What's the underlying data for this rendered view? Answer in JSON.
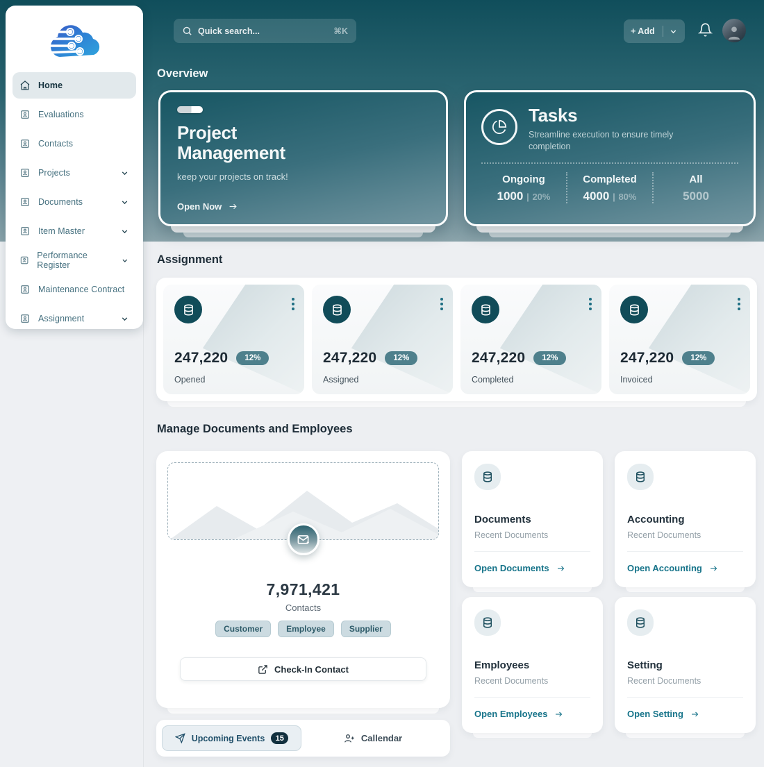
{
  "header": {
    "search_placeholder": "Quick search...",
    "search_shortcut": "⌘K",
    "add_button": "+ Add"
  },
  "sidebar": {
    "items": [
      {
        "label": "Home"
      },
      {
        "label": "Evaluations"
      },
      {
        "label": "Contacts"
      },
      {
        "label": "Projects"
      },
      {
        "label": "Documents"
      },
      {
        "label": "Item Master"
      },
      {
        "label": "Performance Register"
      },
      {
        "label": "Maintenance Contract"
      },
      {
        "label": "Assignment"
      }
    ]
  },
  "overview": {
    "title": "Overview",
    "project_card": {
      "title": "Project Management",
      "subtitle": "keep your projects on track!",
      "cta": "Open Now"
    },
    "tasks_card": {
      "title": "Tasks",
      "subtitle": "Streamline execution to ensure timely completion",
      "stats": [
        {
          "label": "Ongoing",
          "value": "1000",
          "sep": "|",
          "pct": "20%"
        },
        {
          "label": "Completed",
          "value": "4000",
          "sep": "|",
          "pct": "80%"
        },
        {
          "label": "All",
          "value": "5000",
          "sep": "",
          "pct": ""
        }
      ]
    }
  },
  "assignment": {
    "title": "Assignment",
    "cards": [
      {
        "value": "247,220",
        "pct": "12%",
        "label": "Opened"
      },
      {
        "value": "247,220",
        "pct": "12%",
        "label": "Assigned"
      },
      {
        "value": "247,220",
        "pct": "12%",
        "label": "Completed"
      },
      {
        "value": "247,220",
        "pct": "12%",
        "label": "Invoiced"
      }
    ]
  },
  "manage": {
    "title": "Manage Documents and Employees",
    "contacts_card": {
      "value": "7,971,421",
      "label": "Contacts",
      "tags": [
        "Customer",
        "Employee",
        "Supplier"
      ],
      "button": "Check-In Contact"
    },
    "cards": [
      {
        "title": "Documents",
        "subtitle": "Recent Documents",
        "link": "Open Documents"
      },
      {
        "title": "Accounting",
        "subtitle": "Recent Documents",
        "link": "Open Accounting"
      },
      {
        "title": "Employees",
        "subtitle": "Recent Documents",
        "link": "Open Employees"
      },
      {
        "title": "Setting",
        "subtitle": "Recent Documents",
        "link": "Open Setting"
      }
    ]
  },
  "footer": {
    "events_label": "Upcoming Events",
    "events_count": "15",
    "calendar_label": "Callendar"
  },
  "colors": {
    "accent_teal": "#17748a",
    "dark_teal": "#114c59",
    "band_top": "#104e5b",
    "band_bottom": "#8ba4ab",
    "page_bg": "#edeff2"
  }
}
